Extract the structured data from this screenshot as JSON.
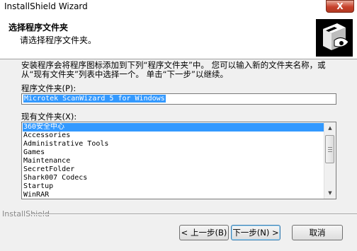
{
  "window": {
    "title": "InstallShield Wizard",
    "close_glyph": "X"
  },
  "header": {
    "title": "选择程序文件夹",
    "subtitle": "请选择程序文件夹。",
    "logo_icon": "installshield-box-icon"
  },
  "description": "安装程序会将程序图标添加到下列“程序文件夹”中。 您可以输入新的文件夹名称，或从“现有文件夹”列表中选择一个。 单击“下一步”以继续。",
  "program_folder": {
    "label": "程序文件夹(P):",
    "value": "Microtek ScanWizard 5 for Windows"
  },
  "existing_folders": {
    "label": "现有文件夹(X):",
    "items": [
      "360安全中心",
      "Accessories",
      "Administrative Tools",
      "Games",
      "Maintenance",
      "SecretFolder",
      "Shark007 Codecs",
      "Startup",
      "WinRAR"
    ],
    "selected_index": 0
  },
  "footer": {
    "brand": "InstallShield",
    "back_label": "< 上一步(B)",
    "next_label": "下一步(N) >",
    "cancel_label": "取消"
  },
  "colors": {
    "selection": "#3399ff",
    "close_button": "#c7412b"
  }
}
